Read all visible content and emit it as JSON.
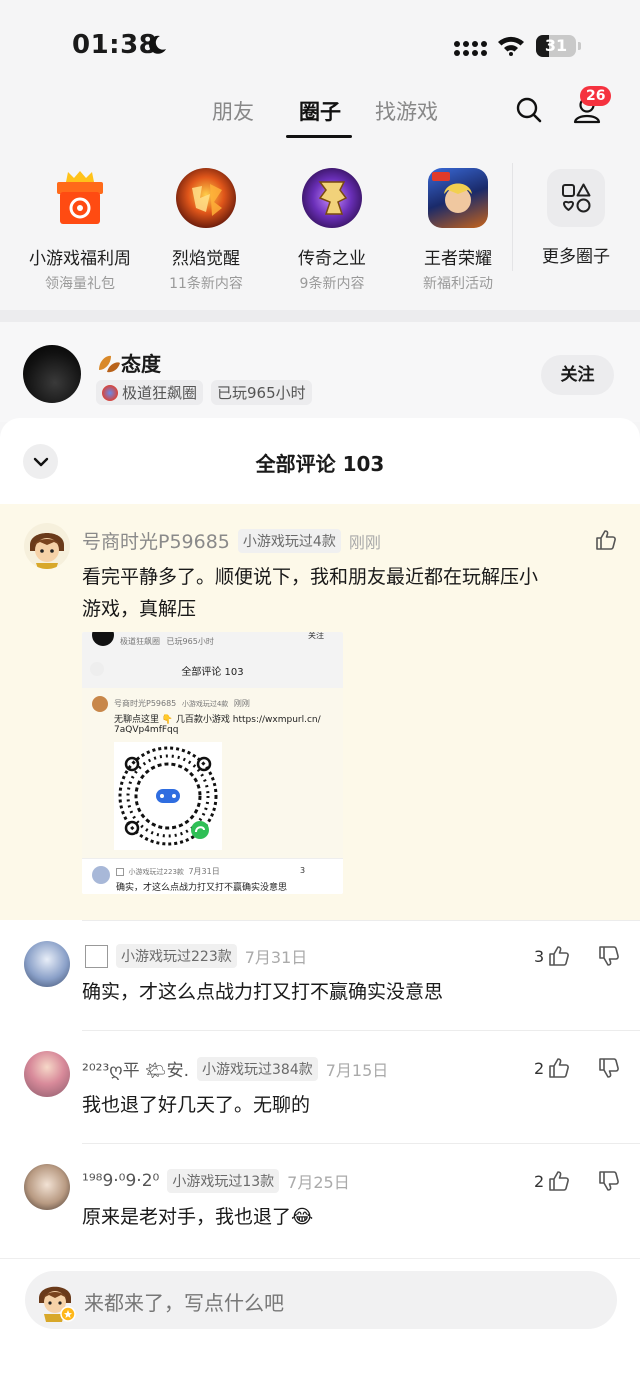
{
  "status_bar": {
    "time": "01:38",
    "battery": "31"
  },
  "nav": {
    "tabs": [
      "朋友",
      "圈子",
      "找游戏"
    ],
    "active_tab": "圈子",
    "notification_count": "26"
  },
  "circles": [
    {
      "name": "小游戏福利周",
      "sub": "领海量礼包",
      "icon": "gift-box-icon"
    },
    {
      "name": "烈焰觉醒",
      "sub": "11条新内容",
      "icon": "game-flame-icon"
    },
    {
      "name": "传奇之业",
      "sub": "9条新内容",
      "icon": "game-dragon-icon"
    },
    {
      "name": "王者荣耀",
      "sub": "新福利活动",
      "icon": "game-hero-icon"
    }
  ],
  "more_circles": {
    "label": "更多圈子",
    "icon": "shapes-grid-icon"
  },
  "post": {
    "author": "态度",
    "circle": "极道狂飙圈",
    "playtime": "已玩965小时",
    "follow_label": "关注"
  },
  "comments_header": {
    "title": "全部评论 103"
  },
  "comments": [
    {
      "name": "号商时光P59685",
      "tag": "小游戏玩过4款",
      "time": "刚刚",
      "text_line1": "看完平静多了。顺便说下，我和朋友最近都在玩解压小",
      "text_line2": "游戏，真解压",
      "likes": ""
    },
    {
      "name": "",
      "tag": "小游戏玩过223款",
      "time": "7月31日",
      "text": "确实，才这么点战力打又打不赢确实没意思",
      "likes": "3"
    },
    {
      "name": "²⁰²³ღ平 🌤安.",
      "tag": "小游戏玩过384款",
      "time": "7月15日",
      "text": "我也退了好几天了。无聊的",
      "likes": "2"
    },
    {
      "name": "¹⁹⁸9·⁰9·2⁰",
      "tag": "小游戏玩过13款",
      "time": "7月25日",
      "text": "原来是老对手，我也退了😂",
      "likes": "2"
    }
  ],
  "embed": {
    "meta_circle": "极道狂飙圈",
    "meta_playtime": "已玩965小时",
    "follow": "关注",
    "title": "全部评论 103",
    "name": "号商时光P59685",
    "tag": "小游戏玩过4款",
    "time": "刚刚",
    "text1": "无聊点这里 👇 几百款小游戏 https://wxmpurl.cn/",
    "text2": "7aQVp4mfFqq",
    "c2_tag": "小游戏玩过223款",
    "c2_time": "7月31日",
    "c2_likes": "3",
    "c2_text": "确实，才这么点战力打又打不赢确实没意思"
  },
  "input": {
    "placeholder": "来都来了，写点什么吧"
  },
  "colors": {
    "badge": "#f5323f",
    "highlight": "#fdf9e9",
    "accent_orange": "#ff5a1f"
  }
}
